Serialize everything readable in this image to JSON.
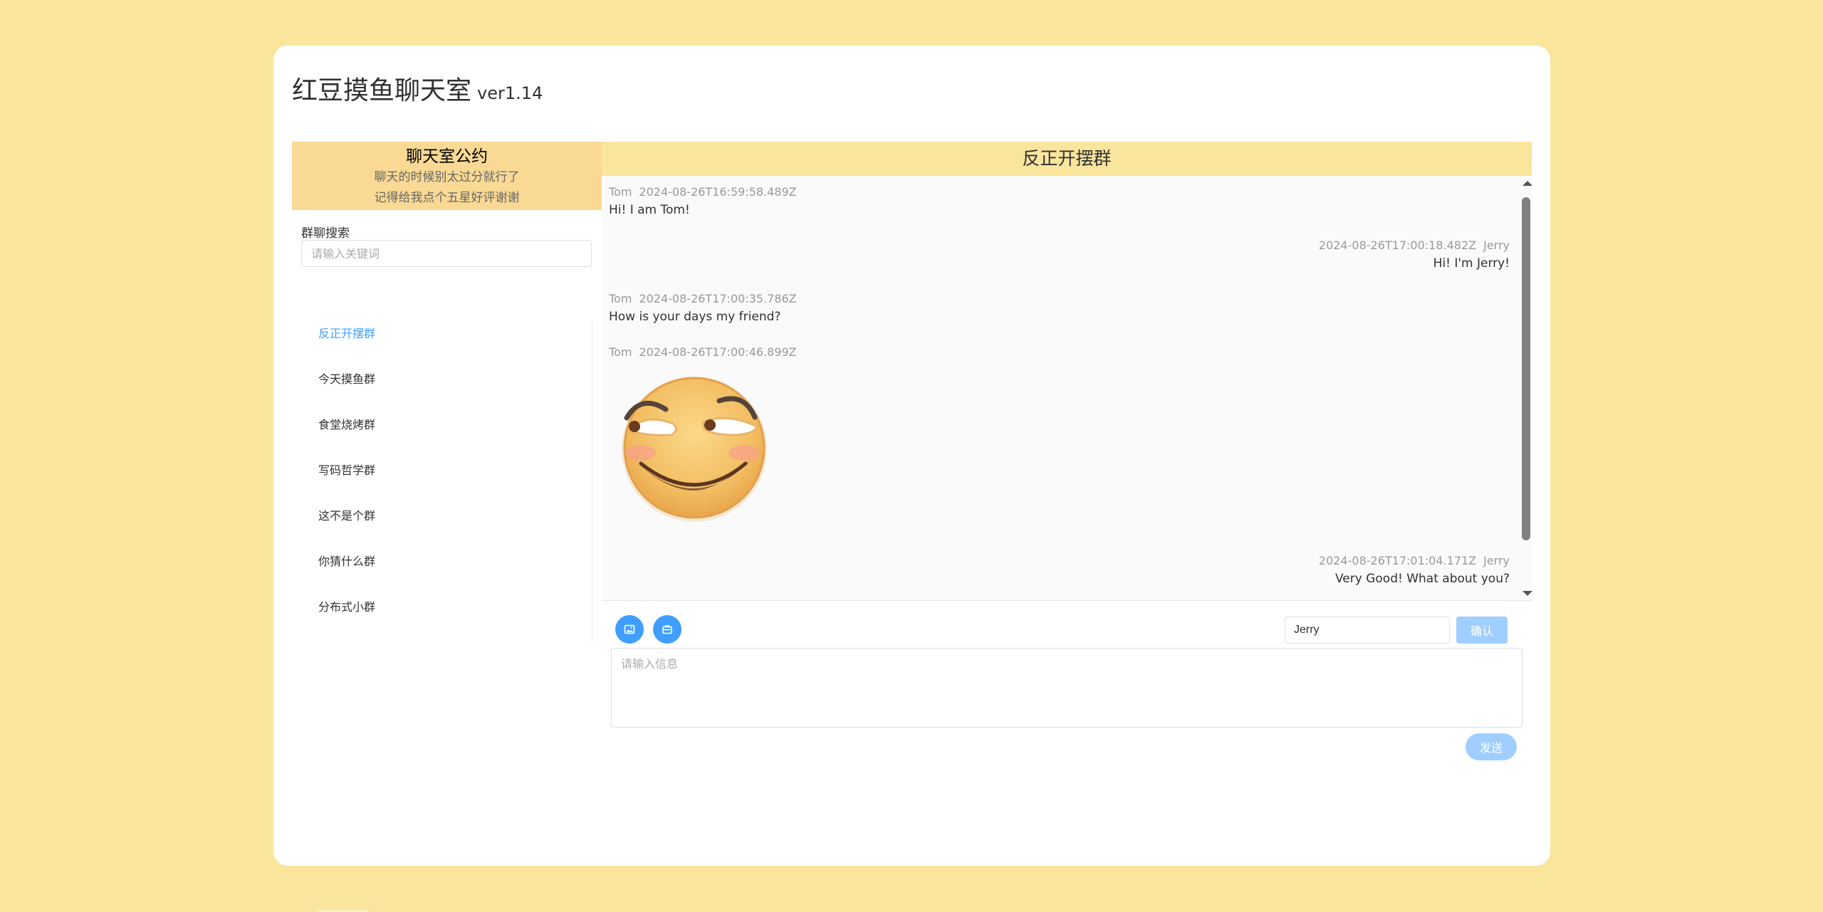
{
  "app": {
    "title": "红豆摸鱼聊天室",
    "version": "ver1.14"
  },
  "sidebar": {
    "rules_title": "聊天室公约",
    "rules_lines": [
      "聊天的时候别太过分就行了",
      "记得给我点个五星好评谢谢"
    ],
    "search_label": "群聊搜索",
    "search_placeholder": "请输入关键词",
    "groups": [
      {
        "label": "反正开摆群",
        "active": true
      },
      {
        "label": "今天摸鱼群",
        "active": false
      },
      {
        "label": "食堂烧烤群",
        "active": false
      },
      {
        "label": "写码哲学群",
        "active": false
      },
      {
        "label": "这不是个群",
        "active": false
      },
      {
        "label": "你猜什么群",
        "active": false
      },
      {
        "label": "分布式小群",
        "active": false
      }
    ]
  },
  "chat": {
    "title": "反正开摆群",
    "messages": [
      {
        "user": "Tom",
        "time": "2024-08-26T16:59:58.489Z",
        "text": "Hi! I am Tom!",
        "side": "left"
      },
      {
        "user": "Jerry",
        "time": "2024-08-26T17:00:18.482Z",
        "text": "Hi! I'm Jerry!",
        "side": "right"
      },
      {
        "user": "Tom",
        "time": "2024-08-26T17:00:35.786Z",
        "text": "How is your days my friend?",
        "side": "left"
      },
      {
        "user": "Tom",
        "time": "2024-08-26T17:00:46.899Z",
        "text": "",
        "image": "smirk-emoji",
        "side": "left"
      },
      {
        "user": "Jerry",
        "time": "2024-08-26T17:01:04.171Z",
        "text": "Very Good! What about you?",
        "side": "right"
      }
    ]
  },
  "composer": {
    "username_value": "Jerry",
    "confirm_label": "确认",
    "message_placeholder": "请输入信息",
    "send_label": "发送",
    "icons": [
      "image-icon",
      "folder-icon"
    ]
  },
  "colors": {
    "page_bg": "#fae59d",
    "rules_bg": "#f9d994",
    "accent": "#409eff",
    "disabled_button": "#a0cfff"
  }
}
